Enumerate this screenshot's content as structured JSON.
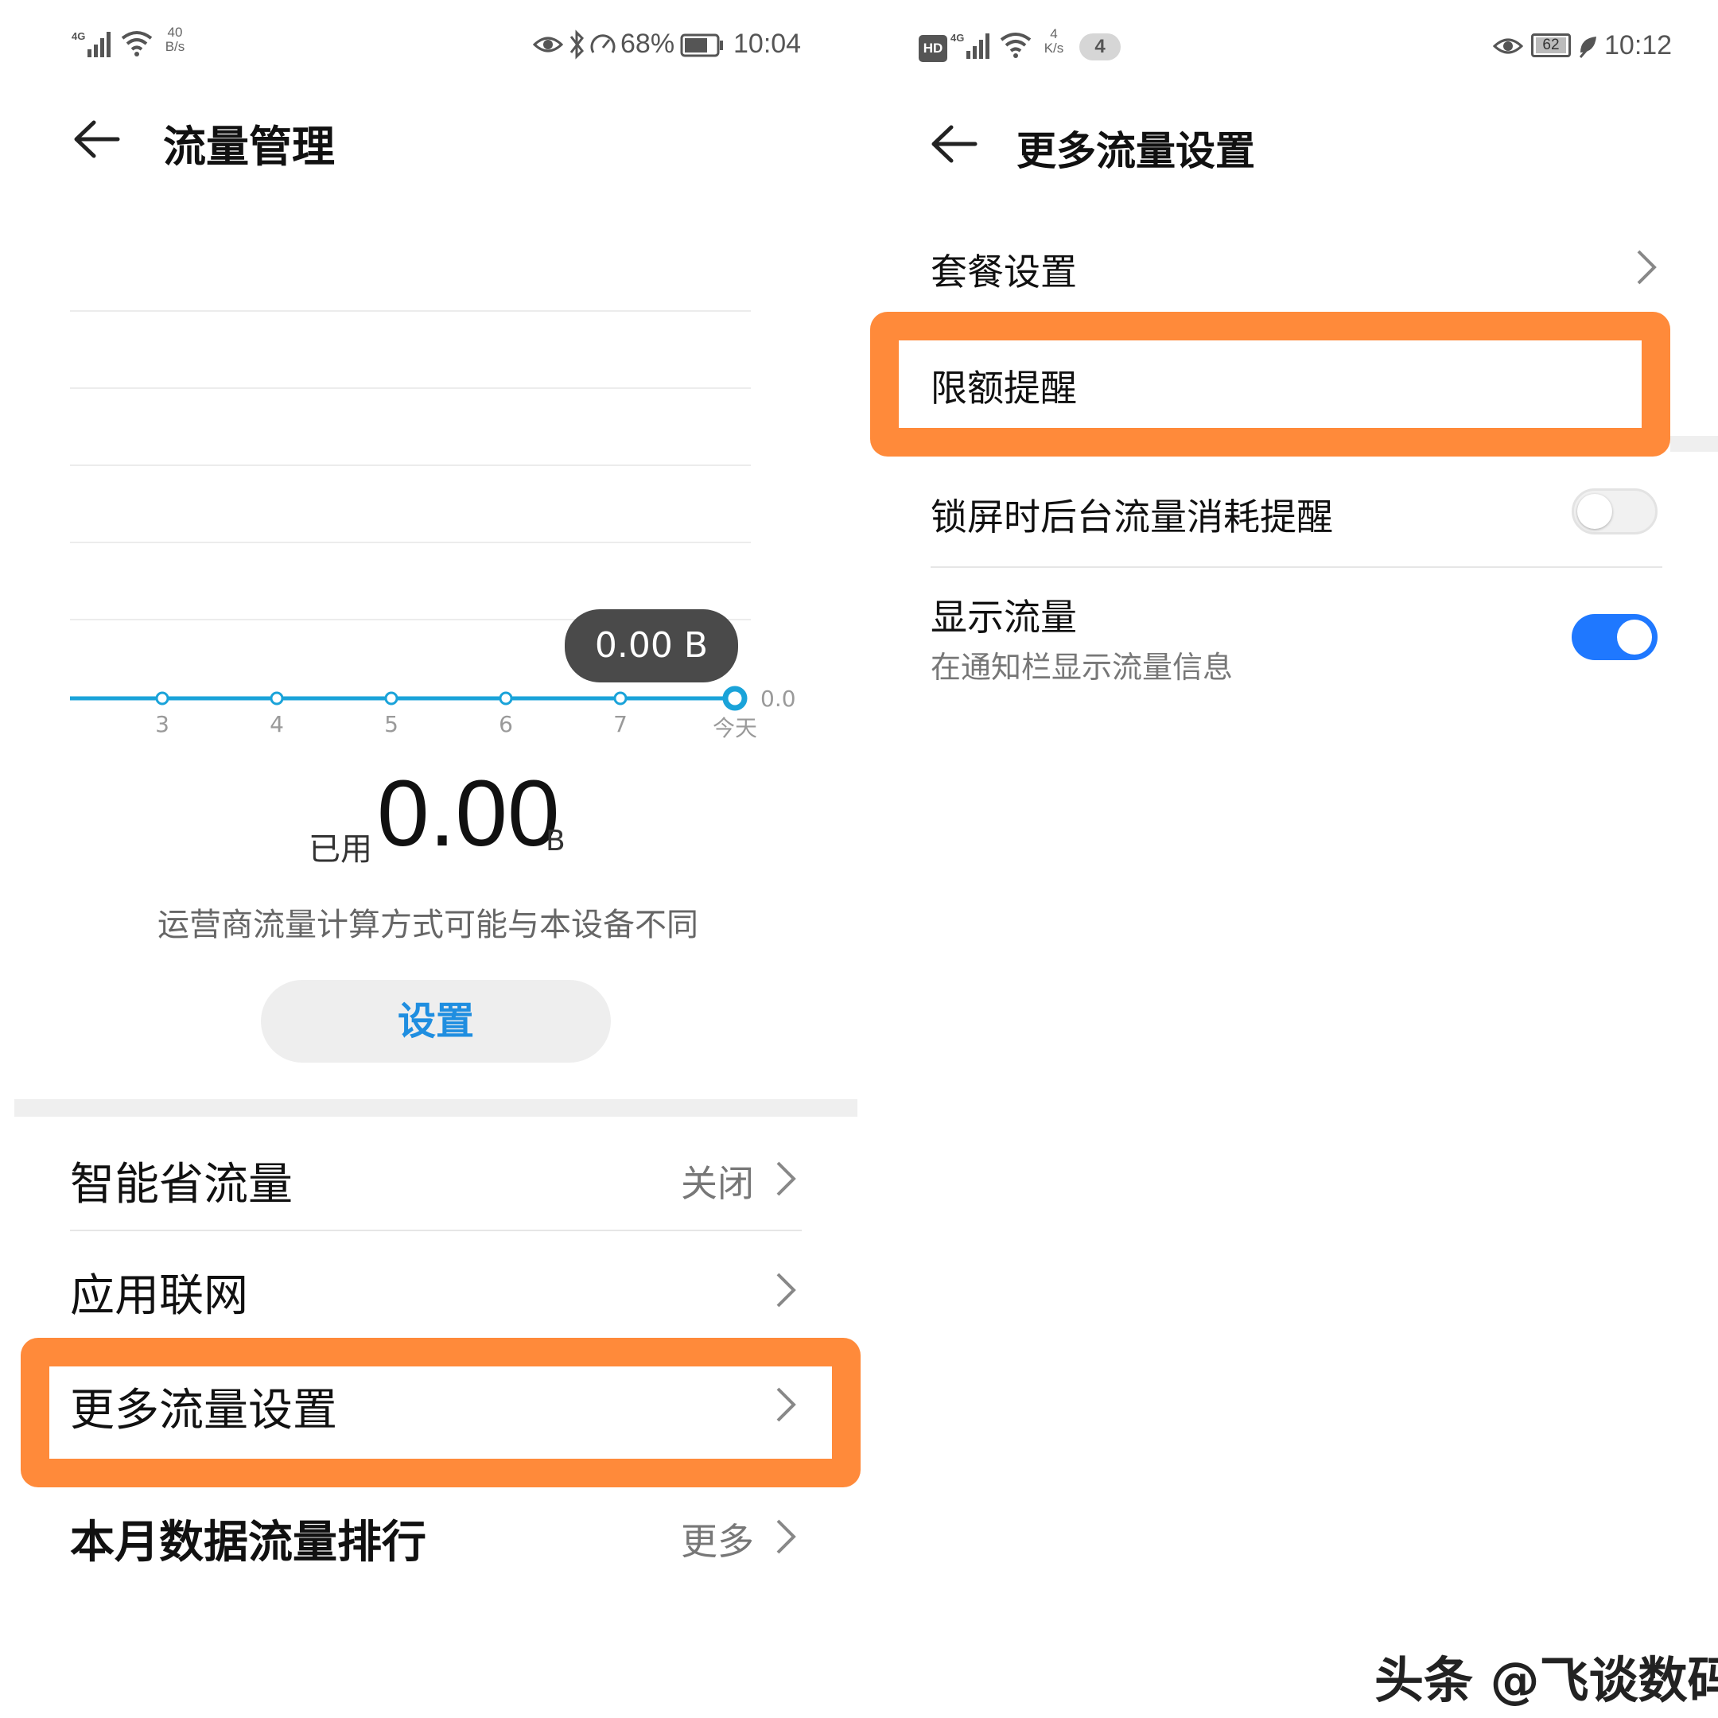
{
  "left": {
    "status_bar": {
      "net_type": "4G",
      "speed_value": "40",
      "speed_unit": "B/s",
      "battery_pct": "68%",
      "time": "10:04"
    },
    "title": "流量管理",
    "chart_data": {
      "type": "line",
      "categories": [
        "3",
        "4",
        "5",
        "6",
        "7",
        "今天"
      ],
      "values": [
        0,
        0,
        0,
        0,
        0,
        0
      ],
      "y_tick_label": "0.0",
      "ylim": [
        0,
        1
      ],
      "tooltip": "0.00 B",
      "color": "#1aa3d9",
      "grid": true
    },
    "usage": {
      "label": "已用",
      "value": "0.00",
      "unit": "B"
    },
    "note": "运营商流量计算方式可能与本设备不同",
    "settings_button": "设置",
    "rows": [
      {
        "label": "智能省流量",
        "value": "关闭"
      },
      {
        "label": "应用联网",
        "value": ""
      },
      {
        "label": "更多流量设置",
        "value": ""
      },
      {
        "label": "本月数据流量排行",
        "value": "更多"
      }
    ]
  },
  "right": {
    "status_bar": {
      "hd_badge": "HD",
      "net_type": "4G",
      "speed_value": "4",
      "speed_unit": "K/s",
      "notification_count": "4",
      "battery_pct": "62",
      "time": "10:12"
    },
    "title": "更多流量设置",
    "rows": [
      {
        "label": "套餐设置"
      },
      {
        "label": "限额提醒"
      },
      {
        "label": "锁屏时后台流量消耗提醒",
        "toggle": false
      },
      {
        "label": "显示流量",
        "sublabel": "在通知栏显示流量信息",
        "toggle": true
      }
    ]
  },
  "watermark": "头条 @飞谈数码",
  "colors": {
    "accent_blue": "#1f8ee0",
    "chart_line": "#1aa3d9",
    "highlight_orange": "#ff8a3a",
    "toggle_on": "#1f78ff"
  }
}
